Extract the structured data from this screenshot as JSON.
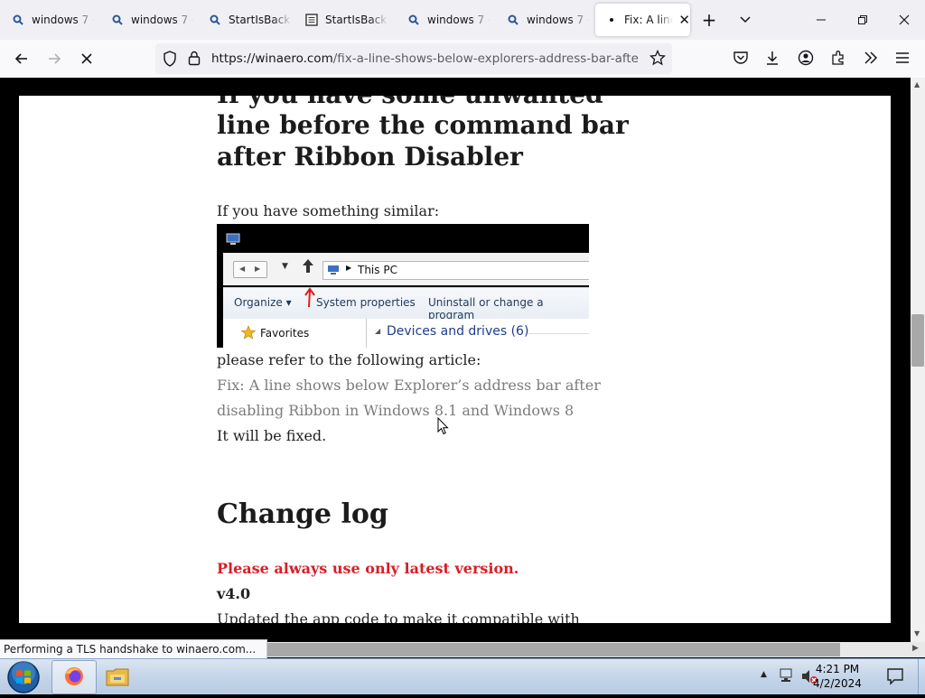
{
  "browser": {
    "tabs": [
      {
        "title": "windows 7 -",
        "icon": "search-icon"
      },
      {
        "title": "windows 7 -",
        "icon": "search-icon"
      },
      {
        "title": "StartIsBack -",
        "icon": "search-icon"
      },
      {
        "title": "StartIsBack /",
        "icon": "page-icon"
      },
      {
        "title": "windows 7 -",
        "icon": "search-icon"
      },
      {
        "title": "windows 7 -",
        "icon": "search-icon"
      },
      {
        "title": "Fix: A line",
        "icon": "loading-dot-icon",
        "active": true
      }
    ],
    "url_domain": "https://winaero.com",
    "url_path": "/fix-a-line-shows-below-explorers-address-bar-after-disab"
  },
  "article": {
    "heading_top": "If you have some unwanted",
    "heading_line2": "line before the command bar",
    "heading_line3": "after Ribbon Disabler",
    "p_similar": "If you have something similar:",
    "p_refer": "please refer to the following article:",
    "link_line1": "Fix: A line shows below Explorer’s address bar after",
    "link_line2": "disabling Ribbon in Windows 8.1 and Windows 8",
    "p_fixed": "It will be fixed.",
    "h_changelog": "Change log",
    "warning": "Please always use only latest version.",
    "version": "v4.0",
    "p_updated": "Updated the app code to make it compatible with",
    "colors": {
      "warning": "#d81f26",
      "link": "#7c7c7c"
    }
  },
  "explorer_shot": {
    "address": "This PC",
    "organize": "Organize ▾",
    "system_properties": "System properties",
    "uninstall": "Uninstall or change a program",
    "favorites": "Favorites",
    "devices": "Devices and drives (6)"
  },
  "status_text": "Performing a TLS handshake to winaero.com...",
  "clock": {
    "time": "4:21 PM",
    "date": "4/2/2024"
  }
}
